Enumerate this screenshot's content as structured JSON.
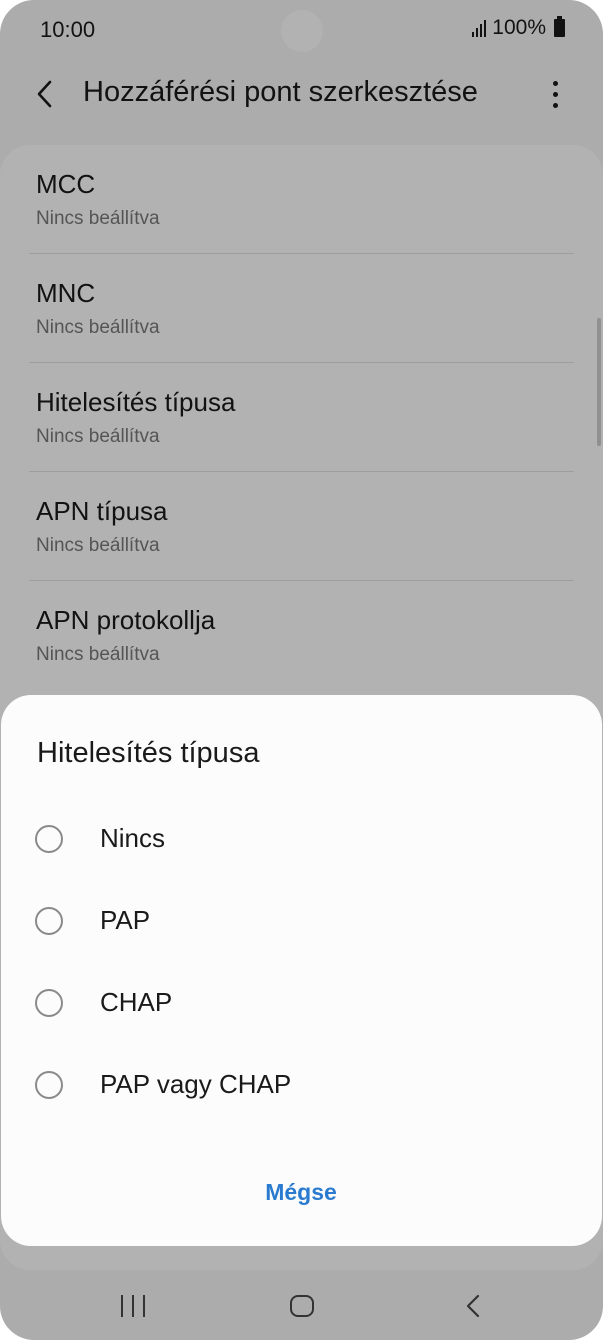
{
  "status_bar": {
    "time": "10:00",
    "battery_text": "100%"
  },
  "app_bar": {
    "title": "Hozzáférési pont szerkesztése"
  },
  "settings": [
    {
      "title": "MCC",
      "value": "Nincs beállítva"
    },
    {
      "title": "MNC",
      "value": "Nincs beállítva"
    },
    {
      "title": "Hitelesítés típusa",
      "value": "Nincs beállítva"
    },
    {
      "title": "APN típusa",
      "value": "Nincs beállítva"
    },
    {
      "title": "APN protokollja",
      "value": "Nincs beállítva"
    }
  ],
  "dialog": {
    "title": "Hitelesítés típusa",
    "options": [
      {
        "label": "Nincs",
        "selected": false
      },
      {
        "label": "PAP",
        "selected": false
      },
      {
        "label": "CHAP",
        "selected": false
      },
      {
        "label": "PAP vagy CHAP",
        "selected": false
      }
    ],
    "cancel_label": "Mégse"
  },
  "colors": {
    "accent": "#2a7bd0",
    "scrim": "#000000"
  },
  "icons": {
    "back": "chevron-left-icon",
    "more": "more-vertical-icon",
    "nav_recents": "recents-icon",
    "nav_home": "home-icon",
    "nav_back": "back-icon"
  }
}
